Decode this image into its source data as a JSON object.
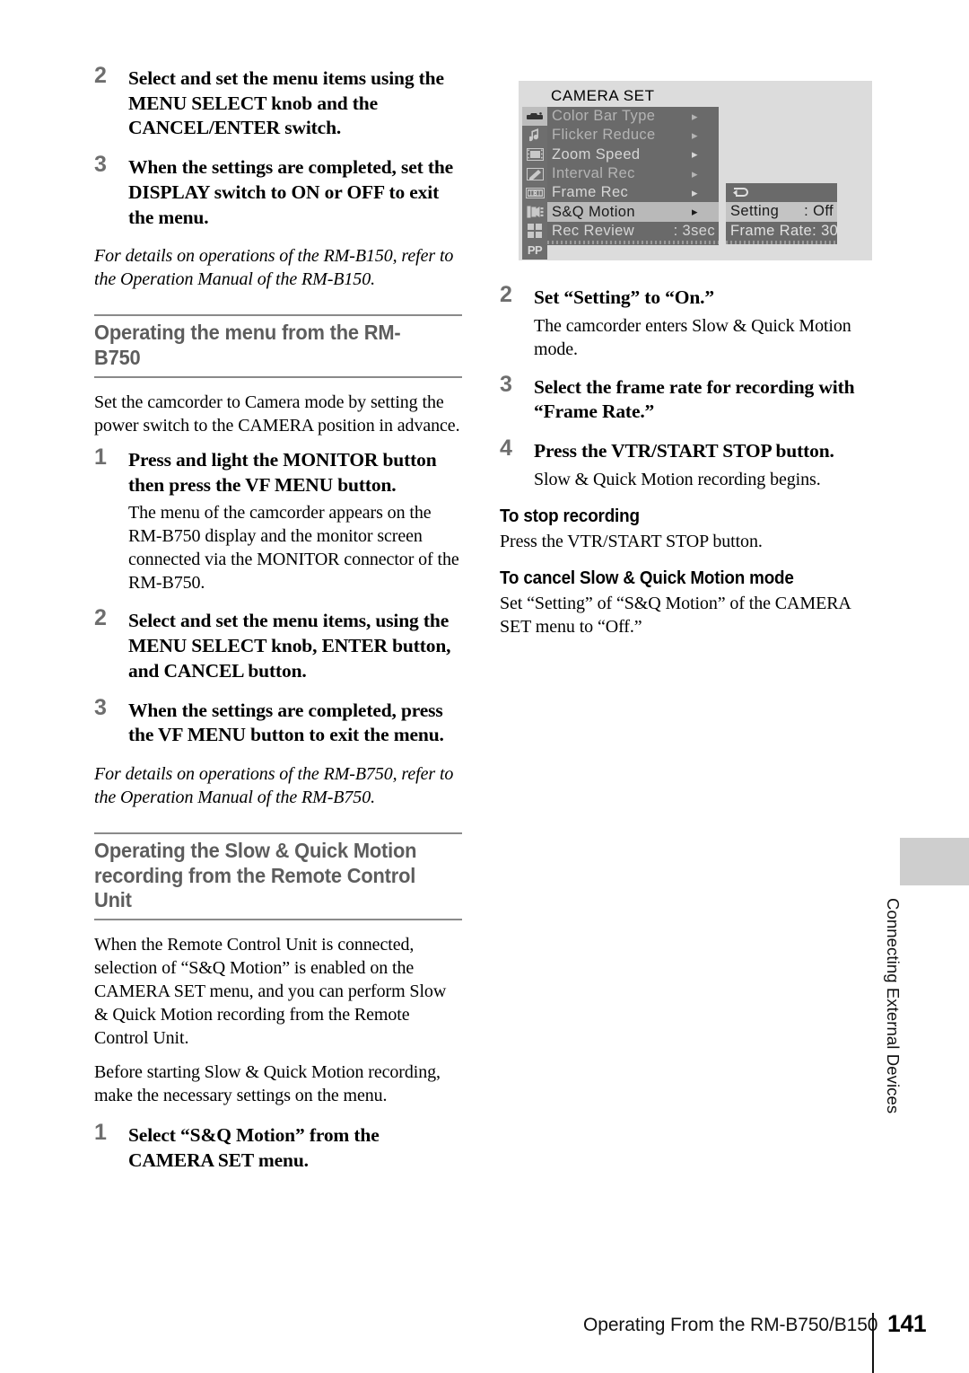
{
  "left_column": {
    "steps_top": [
      {
        "num": "2",
        "title": "Select and set the menu items using the MENU SELECT knob and the CANCEL/ENTER switch."
      },
      {
        "num": "3",
        "title": "When the settings are completed, set the DISPLAY switch to ON or OFF to exit the menu."
      }
    ],
    "note_b150": "For details on operations of the RM-B150, refer to the Operation Manual of the RM-B150.",
    "section1_heading": "Operating the menu from the RM-B750",
    "section1_intro": "Set the camcorder to Camera mode by setting the power switch to the CAMERA position in advance.",
    "steps_b750": [
      {
        "num": "1",
        "title": "Press and light the MONITOR button then press the VF MENU button.",
        "body": "The menu of the camcorder appears on the RM-B750 display and the monitor screen connected via the MONITOR connector of the RM-B750."
      },
      {
        "num": "2",
        "title": "Select and set the menu items, using the MENU SELECT knob, ENTER button, and CANCEL button.",
        "body": ""
      },
      {
        "num": "3",
        "title": "When the settings are completed, press the VF MENU button to exit the menu.",
        "body": ""
      }
    ],
    "note_b750": "For details on operations of the RM-B750, refer to the Operation Manual of the RM-B750.",
    "section2_heading_line1": "Operating the Slow & Quick Motion",
    "section2_heading_line2": "recording from the Remote Control Unit",
    "section2_para1": "When the Remote Control Unit is connected, selection of “S&Q Motion” is enabled on the CAMERA SET menu, and you can perform Slow & Quick Motion recording from the Remote Control Unit.",
    "section2_para2": "Before starting Slow & Quick Motion recording, make the necessary settings on the menu.",
    "step_sq_1": {
      "num": "1",
      "title": "Select “S&Q Motion” from the CAMERA SET menu."
    }
  },
  "menu_screenshot": {
    "title": "CAMERA SET",
    "rail_icons": [
      {
        "name": "camera-icon",
        "active": true
      },
      {
        "name": "audio-note-icon",
        "active": false
      },
      {
        "name": "video-film-icon",
        "active": false
      },
      {
        "name": "screen-pencil-icon",
        "active": false
      },
      {
        "name": "timecode-icon",
        "active": false,
        "label": "00:00"
      },
      {
        "name": "output-display-icon",
        "active": false
      },
      {
        "name": "grid-squares-icon",
        "active": false
      },
      {
        "name": "picture-profile-icon",
        "active": false,
        "label": "PP"
      }
    ],
    "rows": [
      {
        "label": "Color Bar Type",
        "arrow": "▸",
        "value": "",
        "selected": false,
        "dim": true
      },
      {
        "label": "Flicker Reduce",
        "arrow": "▸",
        "value": "",
        "selected": false,
        "dim": true
      },
      {
        "label": "Zoom Speed",
        "arrow": "▸",
        "value": "",
        "selected": false,
        "dim": false
      },
      {
        "label": "Interval Rec",
        "arrow": "▸",
        "value": "",
        "selected": false,
        "dim": true
      },
      {
        "label": "Frame Rec",
        "arrow": "▸",
        "value": "",
        "selected": false,
        "dim": false
      },
      {
        "label": "S&Q Motion",
        "arrow": "▸",
        "value": "",
        "selected": true,
        "dim": false
      },
      {
        "label": "Rec Review",
        "arrow": "",
        "value": ": 3sec",
        "selected": false,
        "dim": false
      }
    ],
    "sub_panel": {
      "return_icon": "↵",
      "rows": [
        {
          "label": "Setting",
          "value": ": Off",
          "selected": true
        },
        {
          "label": "Frame Rate",
          "value": ": 30",
          "selected": false
        }
      ]
    }
  },
  "right_column": {
    "steps": [
      {
        "num": "2",
        "title": "Set “Setting” to “On.”",
        "body": "The camcorder enters Slow & Quick Motion mode."
      },
      {
        "num": "3",
        "title": "Select the frame rate for recording with “Frame Rate.”",
        "body": ""
      },
      {
        "num": "4",
        "title": "Press the VTR/START STOP button.",
        "body": "Slow & Quick Motion recording begins."
      }
    ],
    "stop_heading": "To stop recording",
    "stop_body": "Press the VTR/START STOP button.",
    "cancel_heading": "To cancel Slow & Quick Motion mode",
    "cancel_body": "Set “Setting” of “S&Q Motion” of the CAMERA SET menu to “Off.”"
  },
  "side_tab": {
    "text": "Connecting External Devices"
  },
  "footer": {
    "title": "Operating From the RM-B750/B150",
    "page_number": "141"
  }
}
